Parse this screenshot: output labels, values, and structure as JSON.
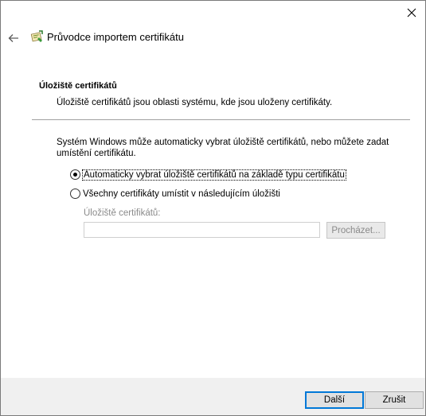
{
  "header": {
    "title": "Průvodce importem certifikátu"
  },
  "section": {
    "title": "Úložiště certifikátů",
    "description": "Úložiště certifikátů jsou oblasti systému, kde jsou uloženy certifikáty."
  },
  "info_text": "Systém Windows může automaticky vybrat úložiště certifikátů, nebo můžete zadat umístění certifikátu.",
  "options": {
    "auto": {
      "label": "Automaticky vybrat úložiště certifikátů na základě typu certifikátu",
      "selected": true
    },
    "manual": {
      "label": "Všechny certifikáty umístit v následujícím úložišti",
      "selected": false
    }
  },
  "store": {
    "label": "Úložiště certifikátů:",
    "value": "",
    "browse_label": "Procházet..."
  },
  "footer": {
    "next_label": "Další",
    "cancel_label": "Zrušit"
  },
  "colors": {
    "accent": "#0078d7",
    "footer_bg": "#f0f0f0",
    "disabled_text": "#8a8a8a"
  },
  "icons": [
    "close-icon",
    "back-arrow-icon",
    "certificate-wizard-icon"
  ]
}
